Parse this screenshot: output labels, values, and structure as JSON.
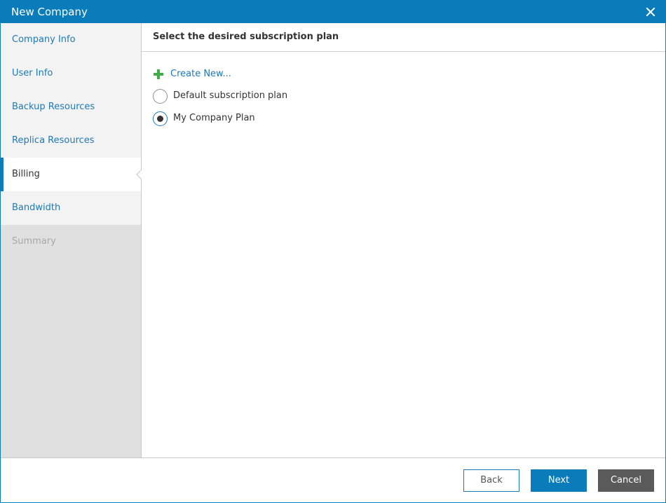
{
  "dialog": {
    "title": "New Company",
    "accent_color": "#0b7cba"
  },
  "sidebar": {
    "items": [
      {
        "label": "Company Info",
        "state": "link"
      },
      {
        "label": "User Info",
        "state": "link"
      },
      {
        "label": "Backup Resources",
        "state": "link"
      },
      {
        "label": "Replica Resources",
        "state": "link"
      },
      {
        "label": "Billing",
        "state": "active"
      },
      {
        "label": "Bandwidth",
        "state": "link"
      },
      {
        "label": "Summary",
        "state": "disabled"
      }
    ]
  },
  "main": {
    "heading": "Select the desired subscription plan",
    "create_new_label": "Create New...",
    "create_new_icon": "plus-icon",
    "plans": [
      {
        "label": "Default subscription plan",
        "selected": false
      },
      {
        "label": "My Company Plan",
        "selected": true
      }
    ]
  },
  "footer": {
    "back_label": "Back",
    "next_label": "Next",
    "cancel_label": "Cancel"
  }
}
